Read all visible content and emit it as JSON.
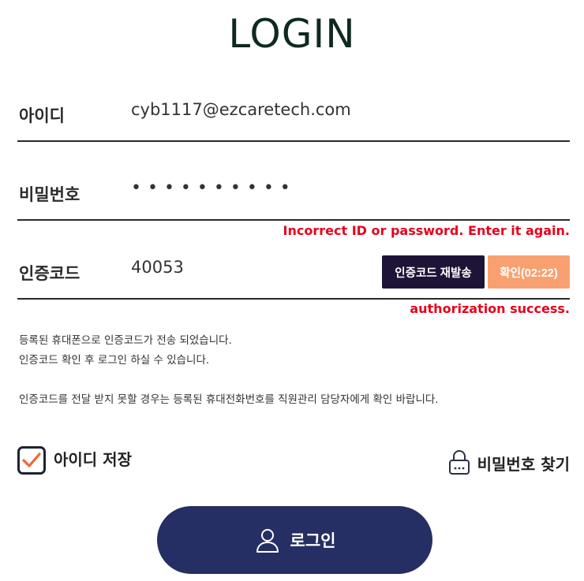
{
  "page": {
    "title": "LOGIN"
  },
  "form": {
    "id": {
      "label": "아이디",
      "value": "cyb1117@ezcaretech.com"
    },
    "password": {
      "label": "비밀번호",
      "masked_value": "••••••••••"
    },
    "id_error": "Incorrect ID or password. Enter it again.",
    "auth": {
      "label": "인증코드",
      "value": "40053",
      "resend_label": "인증코드 재발송",
      "confirm_label": "확인(02:22)",
      "status": "authorization success."
    }
  },
  "notices": [
    "등록된 휴대폰으로 인증코드가 전송 되었습니다.",
    "인증코드 확인 후 로그인 하실 수 있습니다.",
    "인증코드를 전달 받지 못할 경우는 등록된 휴대전화번호를 직원관리 담당자에게 확인 바랍니다."
  ],
  "options": {
    "save_id_label": "아이디 저장",
    "save_id_checked": true,
    "find_password_label": "비밀번호 찾기"
  },
  "login_button": {
    "label": "로그인"
  },
  "colors": {
    "title": "#10291f",
    "error": "#e8001c",
    "resend_bg": "#1e1437",
    "confirm_bg": "#f9a070",
    "checkmark": "#f2663a",
    "login_bg": "#262f63"
  },
  "icons": {
    "checkbox": "checkmark-icon",
    "find_password": "lock-icon",
    "login": "user-icon"
  }
}
